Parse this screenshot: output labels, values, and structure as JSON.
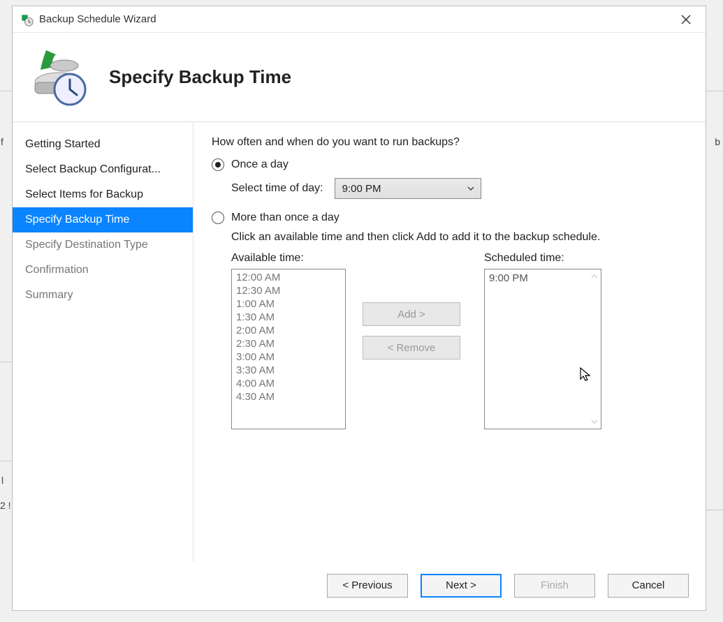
{
  "window": {
    "title": "Backup Schedule Wizard"
  },
  "header": {
    "page_title": "Specify Backup Time"
  },
  "sidebar": {
    "items": [
      {
        "label": "Getting Started",
        "state": "normal"
      },
      {
        "label": "Select Backup Configurat...",
        "state": "normal"
      },
      {
        "label": "Select Items for Backup",
        "state": "normal"
      },
      {
        "label": "Specify Backup Time",
        "state": "selected"
      },
      {
        "label": "Specify Destination Type",
        "state": "inactive"
      },
      {
        "label": "Confirmation",
        "state": "inactive"
      },
      {
        "label": "Summary",
        "state": "inactive"
      }
    ]
  },
  "main": {
    "question": "How often and when do you want to run backups?",
    "radio_once": "Once a day",
    "select_time_label": "Select time of day:",
    "selected_time": "9:00 PM",
    "radio_more": "More than once a day",
    "desc": "Click an available time and then click Add to add it to the backup schedule.",
    "available_label": "Available time:",
    "scheduled_label": "Scheduled time:",
    "available_times": [
      "12:00 AM",
      "12:30 AM",
      "1:00 AM",
      "1:30 AM",
      "2:00 AM",
      "2:30 AM",
      "3:00 AM",
      "3:30 AM",
      "4:00 AM",
      "4:30 AM"
    ],
    "scheduled_times": [
      "9:00 PM"
    ],
    "add_label": "Add >",
    "remove_label": "< Remove"
  },
  "footer": {
    "previous": "< Previous",
    "next": "Next >",
    "finish": "Finish",
    "cancel": "Cancel"
  }
}
